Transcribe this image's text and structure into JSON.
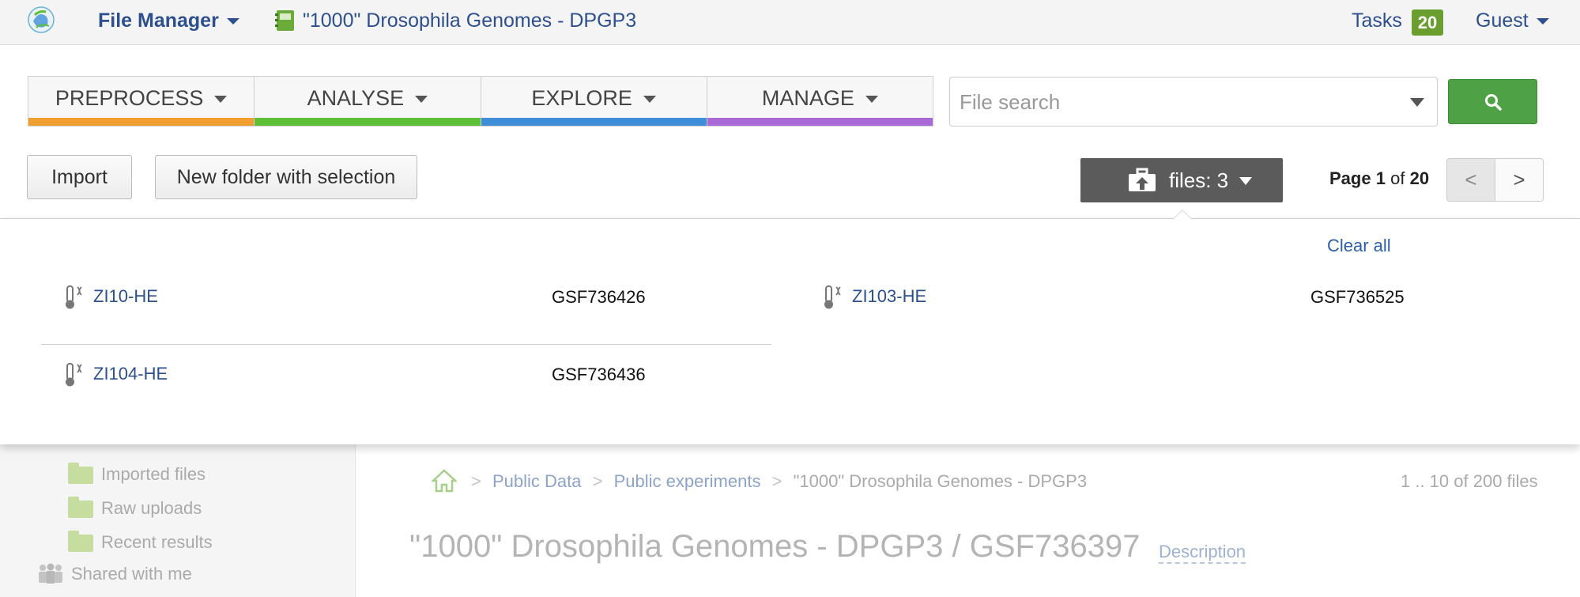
{
  "topbar": {
    "app_name": "File Manager",
    "project_title": "\"1000\" Drosophila Genomes - DPGP3",
    "tasks_label": "Tasks",
    "tasks_count": "20",
    "user_label": "Guest"
  },
  "menu": {
    "tabs": [
      {
        "label": "PREPROCESS",
        "color": "#f0a030"
      },
      {
        "label": "ANALYSE",
        "color": "#5ec036"
      },
      {
        "label": "EXPLORE",
        "color": "#3f8fd8"
      },
      {
        "label": "MANAGE",
        "color": "#a96ad8"
      }
    ]
  },
  "search": {
    "placeholder": "File search",
    "value": ""
  },
  "toolbar": {
    "import_label": "Import",
    "new_folder_label": "New folder with selection",
    "files_label": "files: 3",
    "page_word": "Page",
    "page_current": "1",
    "page_of": "of",
    "page_total": "20",
    "prev_label": "<",
    "next_label": ">"
  },
  "selection_panel": {
    "clear_all_label": "Clear all",
    "files": [
      {
        "name": "ZI10-HE",
        "accession": "GSF736426"
      },
      {
        "name": "ZI103-HE",
        "accession": "GSF736525"
      },
      {
        "name": "ZI104-HE",
        "accession": "GSF736436"
      }
    ]
  },
  "sidebar": {
    "items": [
      {
        "label": "Imported files",
        "icon": "folder-icon"
      },
      {
        "label": "Raw uploads",
        "icon": "folder-icon"
      },
      {
        "label": "Recent results",
        "icon": "search-folder-icon"
      },
      {
        "label": "Shared with me",
        "icon": "people-icon"
      }
    ]
  },
  "breadcrumb": {
    "items": [
      "Public Data",
      "Public experiments",
      "\"1000\" Drosophila Genomes - DPGP3"
    ],
    "separator": ">"
  },
  "file_count_label": "1 .. 10 of 200 files",
  "page_title": "\"1000\" Drosophila Genomes - DPGP3 / GSF736397",
  "description_link": "Description",
  "colors": {
    "brand_blue": "#2d4f8e",
    "tasks_green": "#6a9e2e",
    "search_button_green": "#4ea245"
  }
}
